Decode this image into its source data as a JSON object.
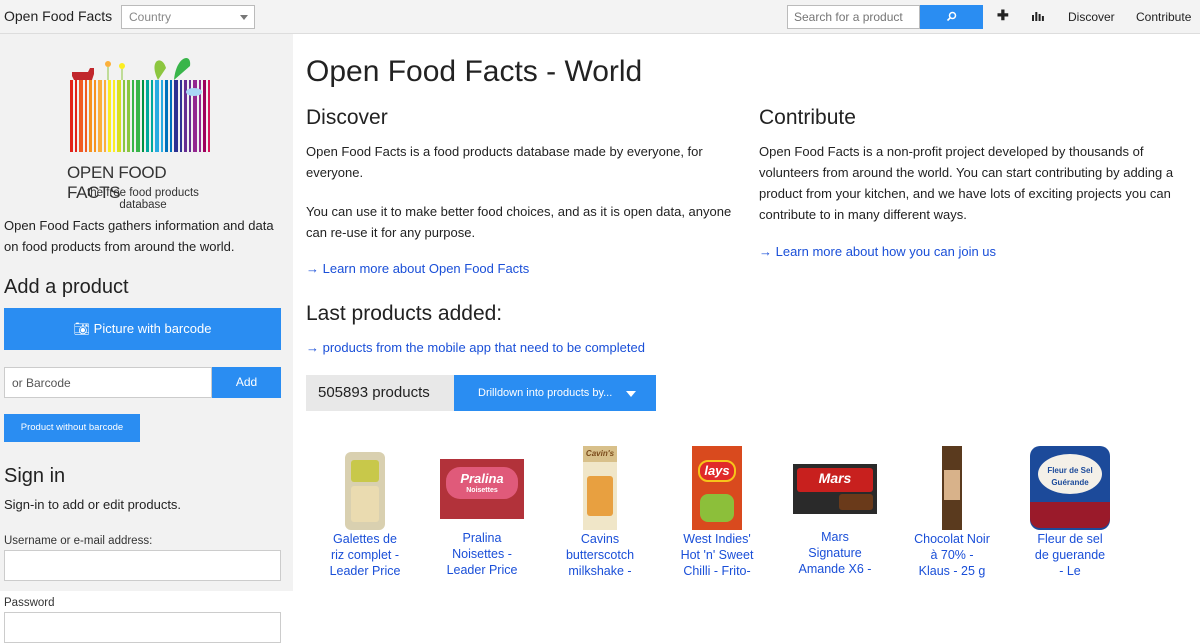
{
  "topbar": {
    "brand": "Open Food Facts",
    "country_placeholder": "Country",
    "search_placeholder": "Search for a product",
    "nav_discover": "Discover",
    "nav_contribute": "Contribute"
  },
  "sidebar": {
    "logo_title": "OPEN FOOD FACTS",
    "logo_subtitle": "the free food products database",
    "intro": "Open Food Facts gathers information and data on food products from around the world.",
    "add_heading": "Add a product",
    "picture_button": "Picture with barcode",
    "barcode_placeholder": "or Barcode",
    "add_button": "Add",
    "no_barcode_button": "Product without barcode",
    "signin_heading": "Sign in",
    "signin_text": "Sign-in to add or edit products.",
    "username_label": "Username or e-mail address:",
    "password_label": "Password"
  },
  "main": {
    "title": "Open Food Facts - World",
    "discover_heading": "Discover",
    "discover_p1": "Open Food Facts is a food products database made by everyone, for everyone.",
    "discover_p2": "You can use it to make better food choices, and as it is open data, anyone can re-use it for any purpose.",
    "learn_more_link": "→ Learn more about Open Food Facts",
    "contribute_heading": "Contribute",
    "contribute_p": "Open Food Facts is a non-profit project developed by thousands of volunteers from around the world. You can start contributing by adding a product from your kitchen, and we have lots of exciting projects you can contribute to in many different ways.",
    "join_link": "→ Learn more about how you can join us",
    "last_heading": "Last products added:",
    "mobile_link": "→ products from the mobile app that need to be completed",
    "product_count": "505893 products",
    "drilldown_button": "Drilldown into products by..."
  },
  "products": [
    {
      "line1": "Galettes de",
      "line2": "riz complet -",
      "line3": "Leader Price"
    },
    {
      "line1": "Pralina",
      "line2": "Noisettes -",
      "line3": "Leader Price"
    },
    {
      "line1": "Cavins",
      "line2": "butterscotch",
      "line3": "milkshake -"
    },
    {
      "line1": "West Indies'",
      "line2": "Hot 'n' Sweet",
      "line3": "Chilli - Frito-"
    },
    {
      "line1": "Mars",
      "line2": "Signature",
      "line3": "Amande X6 -"
    },
    {
      "line1": "Chocolat Noir",
      "line2": "à 70% -",
      "line3": "Klaus - 25 g"
    },
    {
      "line1": "Fleur de sel",
      "line2": "de guerande",
      "line3": "- Le"
    }
  ],
  "package_text": {
    "pralina": "Pralina",
    "pralina_sub": "Noisettes",
    "cavins": "Cavin's",
    "lays": "lays",
    "mars": "Mars",
    "fleur": "Fleur de Sel",
    "fleur2": "Guérande"
  },
  "colors": {
    "accent": "#2a8df2",
    "link": "#1a4fd8",
    "sidebar_bg": "#f2f2f2"
  }
}
